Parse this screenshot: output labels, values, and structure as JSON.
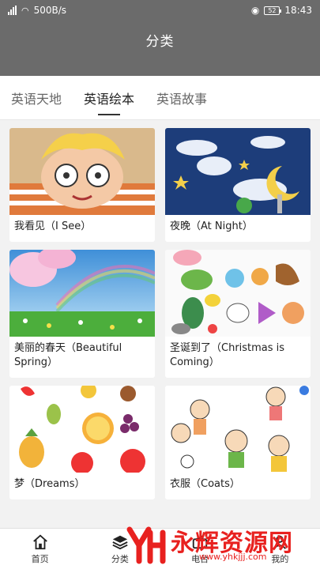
{
  "status": {
    "speed": "500B/s",
    "battery": "52",
    "time": "18:43"
  },
  "header": {
    "title": "分类"
  },
  "tabs": [
    {
      "label": "英语天地"
    },
    {
      "label": "英语绘本"
    },
    {
      "label": "英语故事"
    }
  ],
  "cards": [
    {
      "caption": "我看见（I See）"
    },
    {
      "caption": "夜晚（At Night）"
    },
    {
      "caption": "美丽的春天（Beautiful Spring）"
    },
    {
      "caption": "圣诞到了（Christmas is Coming）"
    },
    {
      "caption": "梦（Dreams）"
    },
    {
      "caption": "衣服（Coats）"
    }
  ],
  "bottom_nav": [
    {
      "label": "首页",
      "icon": "home-icon"
    },
    {
      "label": "分类",
      "icon": "layers-icon"
    },
    {
      "label": "电台",
      "icon": "radio-icon"
    },
    {
      "label": "我的",
      "icon": "user-icon"
    }
  ],
  "watermark": {
    "text": "永辉资源网",
    "url": "www.yhkjjj.com"
  },
  "colors": {
    "header_bg": "#6b6b6b",
    "tab_indicator": "#333333",
    "watermark_red": "#e8211f"
  }
}
